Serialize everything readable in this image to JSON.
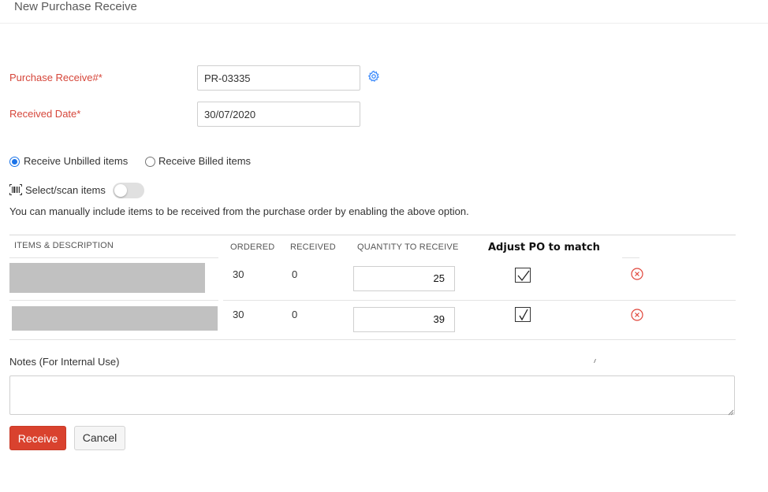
{
  "page": {
    "title": "New Purchase Receive"
  },
  "form": {
    "receive_number": {
      "label": "Purchase Receive#*",
      "value": "PR-03335"
    },
    "received_date": {
      "label": "Received Date*",
      "value": "30/07/2020"
    },
    "receive_options": [
      {
        "label": "Receive Unbilled items",
        "selected": true
      },
      {
        "label": "Receive Billed items",
        "selected": false
      }
    ],
    "scan": {
      "label": "Select/scan items",
      "enabled": false
    },
    "hint": "You can manually include items to be received from the purchase order by enabling the above option."
  },
  "items_table": {
    "headers": {
      "item": "ITEMS & DESCRIPTION",
      "ordered": "ORDERED",
      "received": "RECEIVED",
      "quantity": "QUANTITY TO RECEIVE",
      "adjust": "Adjust PO to match"
    },
    "rows": [
      {
        "ordered": "30",
        "received": "0",
        "quantity": "25",
        "adjust_checked": true
      },
      {
        "ordered": "30",
        "received": "0",
        "quantity": "39",
        "adjust_checked": true
      }
    ]
  },
  "notes": {
    "label": "Notes (For Internal Use)",
    "value": ""
  },
  "actions": {
    "receive_label": "Receive",
    "cancel_label": "Cancel"
  },
  "colors": {
    "accent": "#d9422e",
    "link": "#408dfb",
    "required_label": "#d6463a"
  }
}
